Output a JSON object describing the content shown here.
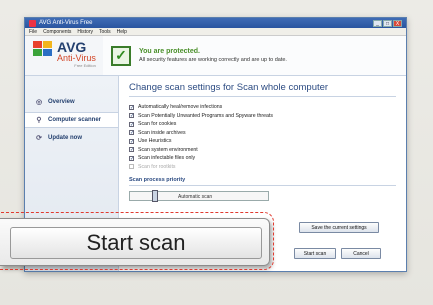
{
  "window": {
    "title": "AVG Anti-Virus Free",
    "controls": [
      "_",
      "□",
      "X"
    ]
  },
  "menu": [
    "File",
    "Components",
    "History",
    "Tools",
    "Help"
  ],
  "brand": {
    "name": "AVG",
    "product": "Anti-Virus",
    "edition": "Free Edition"
  },
  "status": {
    "title": "You are protected.",
    "description": "All security features are working correctly and are up to date."
  },
  "sidebar": {
    "items": [
      {
        "label": "Overview",
        "icon": "overview-icon"
      },
      {
        "label": "Computer scanner",
        "icon": "search-icon"
      },
      {
        "label": "Update now",
        "icon": "update-icon"
      }
    ]
  },
  "main": {
    "title": "Change scan settings for Scan whole computer",
    "options": [
      {
        "label": "Automatically heal/remove infections",
        "checked": true,
        "enabled": true
      },
      {
        "label": "Scan Potentially Unwanted Programs and Spyware threats",
        "checked": true,
        "enabled": true
      },
      {
        "label": "Scan for cookies",
        "checked": true,
        "enabled": true
      },
      {
        "label": "Scan inside archives",
        "checked": true,
        "enabled": true
      },
      {
        "label": "Use Heuristics",
        "checked": true,
        "enabled": true
      },
      {
        "label": "Scan system environment",
        "checked": true,
        "enabled": true
      },
      {
        "label": "Scan infectable files only",
        "checked": true,
        "enabled": true
      },
      {
        "label": "Scan for rootkits",
        "checked": false,
        "enabled": false
      }
    ],
    "priority_title": "Scan process priority",
    "priority_label": "Automatic scan",
    "save_button": "Save the current settings",
    "start_button": "Start scan",
    "cancel_button": "Cancel"
  },
  "zoom_callout": {
    "label": "Start scan"
  },
  "colors": {
    "accent": "#2c4b82",
    "protected_green": "#4a8f2a",
    "callout_border": "#e03a2f"
  }
}
